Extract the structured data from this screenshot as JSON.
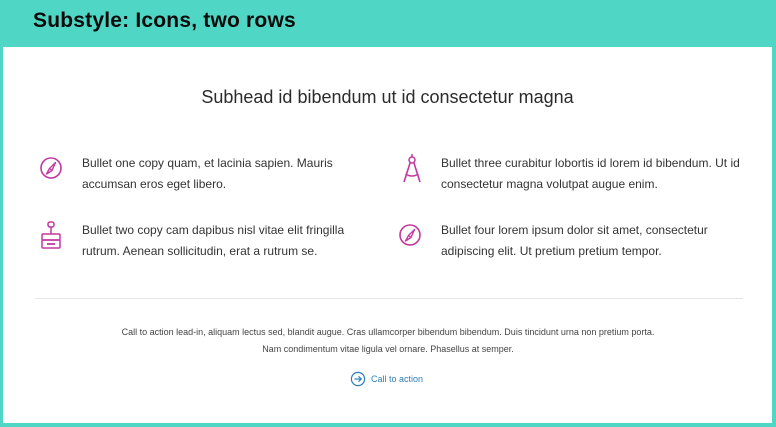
{
  "banner": {
    "title": "Substyle: Icons, two rows"
  },
  "subhead": "Subhead id bibendum ut id consectetur magna",
  "bullets": [
    {
      "icon": "compass-icon",
      "text": "Bullet one copy quam, et lacinia sapien. Mauris accumsan eros eget libero."
    },
    {
      "icon": "stamp-icon",
      "text": "Bullet two copy cam dapibus nisl vitae elit fringilla rutrum. Aenean sollicitudin, erat a rutrum se."
    },
    {
      "icon": "drafting-compass-icon",
      "text": "Bullet three curabitur lobortis id lorem id bibendum. Ut id consectetur magna volutpat augue enim."
    },
    {
      "icon": "compass-icon",
      "text": "Bullet four lorem ipsum dolor sit amet, consectetur adipiscing elit. Ut pretium pretium tempor."
    }
  ],
  "cta": {
    "lead": "Call to action lead-in, aliquam lectus sed, blandit augue. Cras ullamcorper bibendum bibendum. Duis tincidunt urna non pretium porta. Nam condimentum vitae ligula vel ornare. Phasellus at semper.",
    "link_label": "Call to action",
    "link_icon": "arrow-circle-right-icon"
  },
  "colors": {
    "banner_bg": "#50d6c4",
    "icon_accent": "#c2389f",
    "link": "#2d7fb8"
  }
}
